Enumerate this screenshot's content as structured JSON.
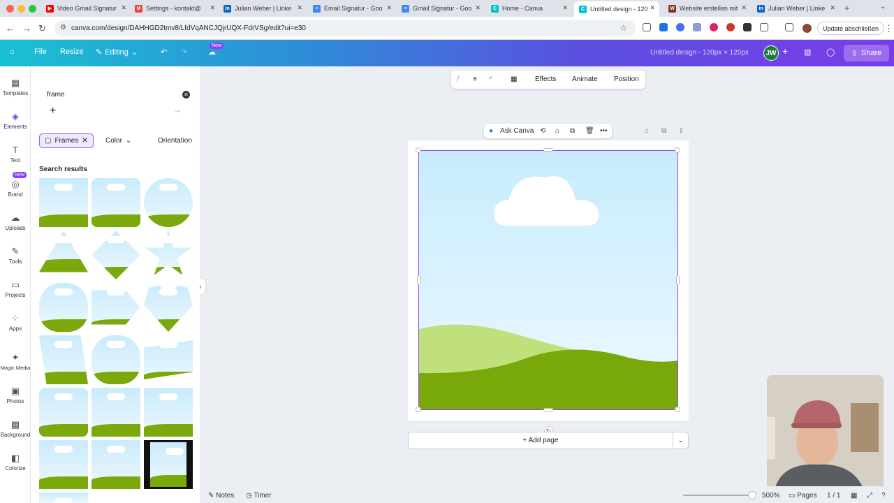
{
  "browser": {
    "tabs": [
      {
        "title": "Video Gmail Signatur",
        "favicon": "youtube-icon",
        "color": "#ff0000"
      },
      {
        "title": "Settings - kontakt@",
        "favicon": "gmail-icon",
        "color": "#ea4335"
      },
      {
        "title": "Julian Weber | Linke",
        "favicon": "linkedin-icon",
        "color": "#0a66c2"
      },
      {
        "title": "Email Signatur - Goo",
        "favicon": "docs-icon",
        "color": "#4285f4"
      },
      {
        "title": "Gmail Signatur - Goo",
        "favicon": "docs-icon",
        "color": "#4285f4"
      },
      {
        "title": "Home - Canva",
        "favicon": "canva-icon",
        "color": "#00c4cc"
      },
      {
        "title": "Untitled design - 120",
        "favicon": "canva-icon",
        "color": "#00c4cc"
      },
      {
        "title": "Website erstellen mit",
        "favicon": "site-icon",
        "color": "#8a2b2b"
      },
      {
        "title": "Julian Weber | Linke",
        "favicon": "linkedin-icon",
        "color": "#0a66c2"
      }
    ],
    "url": "canva.com/design/DAHHGD2tmv8/LfdVqANCJQjrUQX-FdrVSg/edit?ui=e30",
    "update_label": "Update abschließen"
  },
  "header": {
    "file_label": "File",
    "resize_label": "Resize",
    "editing_label": "Editing",
    "new_badge": "New",
    "design_title": "Untitled design - 120px × 120px",
    "avatar_initials": "JW",
    "share_label": "Share"
  },
  "rail": {
    "items": [
      {
        "label": "Templates",
        "icon": "templates-icon"
      },
      {
        "label": "Elements",
        "icon": "elements-icon"
      },
      {
        "label": "Text",
        "icon": "text-icon"
      },
      {
        "label": "Brand",
        "icon": "brand-icon"
      },
      {
        "label": "Uploads",
        "icon": "uploads-icon"
      },
      {
        "label": "Tools",
        "icon": "tools-icon"
      },
      {
        "label": "Projects",
        "icon": "projects-icon"
      },
      {
        "label": "Apps",
        "icon": "apps-icon"
      },
      {
        "label": "Magic Media",
        "icon": "magic-media-icon"
      },
      {
        "label": "Photos",
        "icon": "photos-icon"
      },
      {
        "label": "Background",
        "icon": "background-icon"
      },
      {
        "label": "Colorize",
        "icon": "colorize-icon"
      }
    ],
    "new_badge": "New"
  },
  "panel": {
    "search_value": "frame",
    "chips": [
      {
        "label": "Frames"
      },
      {
        "label": "Color"
      },
      {
        "label": "Orientation"
      }
    ],
    "results_title": "Search results"
  },
  "toolbar": {
    "effects": "Effects",
    "animate": "Animate",
    "position": "Position"
  },
  "page_tools": {
    "ask_canva": "Ask Canva"
  },
  "canvas": {
    "add_page": "+ Add page",
    "sky_color": "#cdeefc",
    "grass_light": "#bfe07a",
    "grass_dark": "#78a80a"
  },
  "footer": {
    "notes": "Notes",
    "timer": "Timer",
    "zoom": "500%",
    "pages_label": "Pages",
    "pages_count": "1 / 1"
  }
}
